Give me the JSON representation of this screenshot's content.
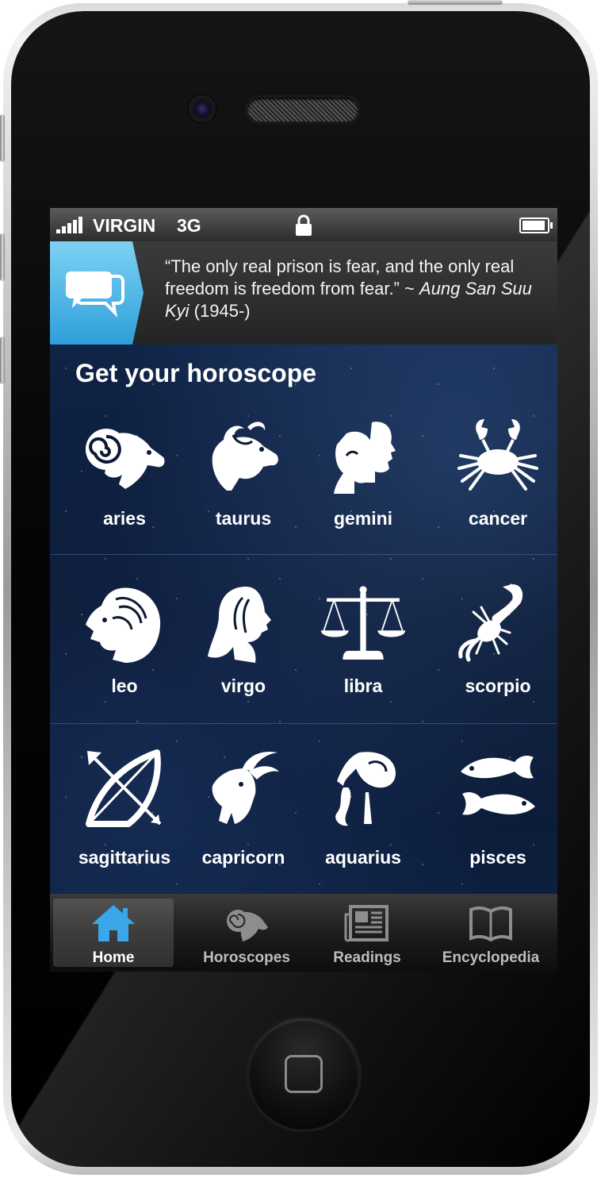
{
  "status_bar": {
    "carrier": "VIRGIN",
    "network": "3G",
    "battery_level": 1.0
  },
  "quote": {
    "text": "“The only real prison is fear, and the only real freedom is freedom from fear.” ~ ",
    "author": "Aung San Suu Kyi",
    "years": " (1945-)"
  },
  "section_title": "Get your horoscope",
  "signs": [
    {
      "label": "aries",
      "icon": "aries-icon"
    },
    {
      "label": "taurus",
      "icon": "taurus-icon"
    },
    {
      "label": "gemini",
      "icon": "gemini-icon"
    },
    {
      "label": "cancer",
      "icon": "cancer-icon"
    },
    {
      "label": "leo",
      "icon": "leo-icon"
    },
    {
      "label": "virgo",
      "icon": "virgo-icon"
    },
    {
      "label": "libra",
      "icon": "libra-icon"
    },
    {
      "label": "scorpio",
      "icon": "scorpio-icon"
    },
    {
      "label": "sagittarius",
      "icon": "sagittarius-icon"
    },
    {
      "label": "capricorn",
      "icon": "capricorn-icon"
    },
    {
      "label": "aquarius",
      "icon": "aquarius-icon"
    },
    {
      "label": "pisces",
      "icon": "pisces-icon"
    }
  ],
  "tabs": [
    {
      "label": "Home",
      "icon": "home-icon",
      "active": true
    },
    {
      "label": "Horoscopes",
      "icon": "ram-icon",
      "active": false
    },
    {
      "label": "Readings",
      "icon": "newspaper-icon",
      "active": false
    },
    {
      "label": "Encyclopedia",
      "icon": "book-icon",
      "active": false
    }
  ],
  "colors": {
    "quote_accent": "#2d9fd9",
    "home_tab_icon": "#3aa7ea",
    "background": "#0b1a33"
  }
}
